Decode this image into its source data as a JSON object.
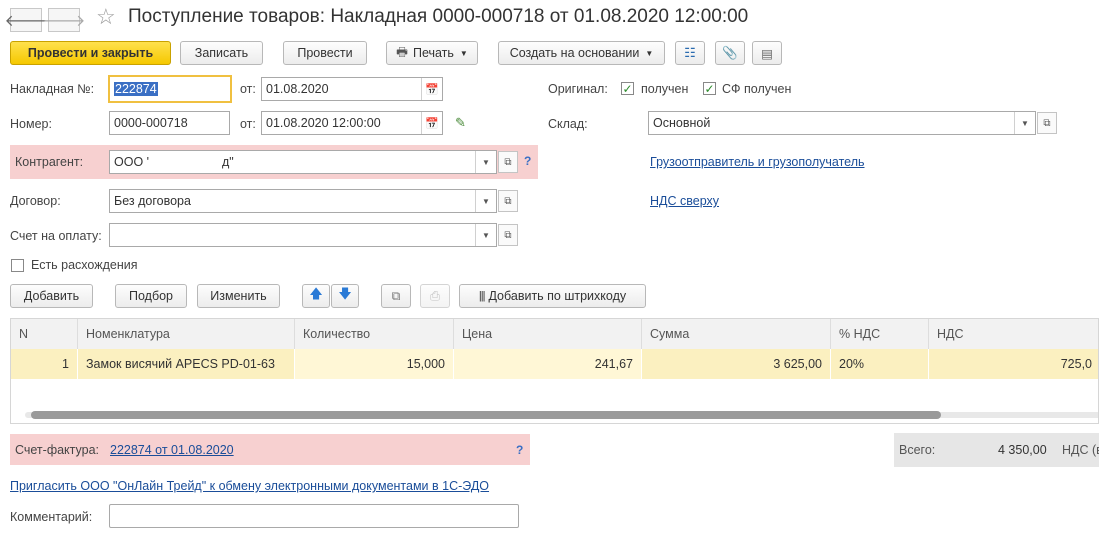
{
  "window": {
    "title": "Поступление товаров: Накладная 0000-000718 от 01.08.2020 12:00:00",
    "back_icon": "back-arrow-icon",
    "forward_icon": "forward-arrow-icon",
    "star": "☆"
  },
  "toolbar": {
    "post_close": "Провести и закрыть",
    "save": "Записать",
    "post": "Провести",
    "print": "Печать",
    "create_based": "Создать на основании"
  },
  "header": {
    "invoice_no_label": "Накладная №:",
    "invoice_no_value": "222874",
    "from_label": "от:",
    "invoice_date": "01.08.2020",
    "number_label": "Номер:",
    "number_value": "0000-000718",
    "from_label2": "от:",
    "number_date": "01.08.2020 12:00:00",
    "original_label": "Оригинал:",
    "received_label": "получен",
    "sf_received_label": "СФ получен",
    "warehouse_label": "Склад:",
    "warehouse_value": "Основной",
    "counterparty_label": "Контрагент:",
    "counterparty_value": "ООО '                     д\"",
    "help": "?",
    "shipper_link": "Грузоотправитель и грузополучатель",
    "contract_label": "Договор:",
    "contract_value": "Без договора",
    "vat_link": "НДС сверху",
    "payment_label": "Счет на оплату:",
    "payment_value": "",
    "discrepancy_label": "Есть расхождения"
  },
  "table_toolbar": {
    "add": "Добавить",
    "pick": "Подбор",
    "edit": "Изменить",
    "add_barcode": "Добавить по штрихкоду"
  },
  "table": {
    "headers": [
      "N",
      "Номенклатура",
      "Количество",
      "Цена",
      "Сумма",
      "% НДС",
      "НДС"
    ],
    "rows": [
      [
        "1",
        "Замок висячий APECS PD-01-63",
        "15,000",
        "241,67",
        "3 625,00",
        "20%",
        "725,0"
      ]
    ]
  },
  "footer": {
    "sf_label": "Счет-фактура:",
    "sf_link": "222874 от 01.08.2020",
    "help": "?",
    "total_label": "Всего:",
    "total_value": "4 350,00",
    "vat_label": "НДС (в",
    "edo_link": "Пригласить ООО \"ОнЛайн Трейд\" к обмену электронными документами в 1С-ЭДО",
    "comment_label": "Комментарий:",
    "comment_value": ""
  },
  "colors": {
    "primary_button": "#f5c800",
    "highlight_row": "#f7d0d0",
    "selected_row": "#fbf0c0",
    "link": "#1a4d99"
  }
}
